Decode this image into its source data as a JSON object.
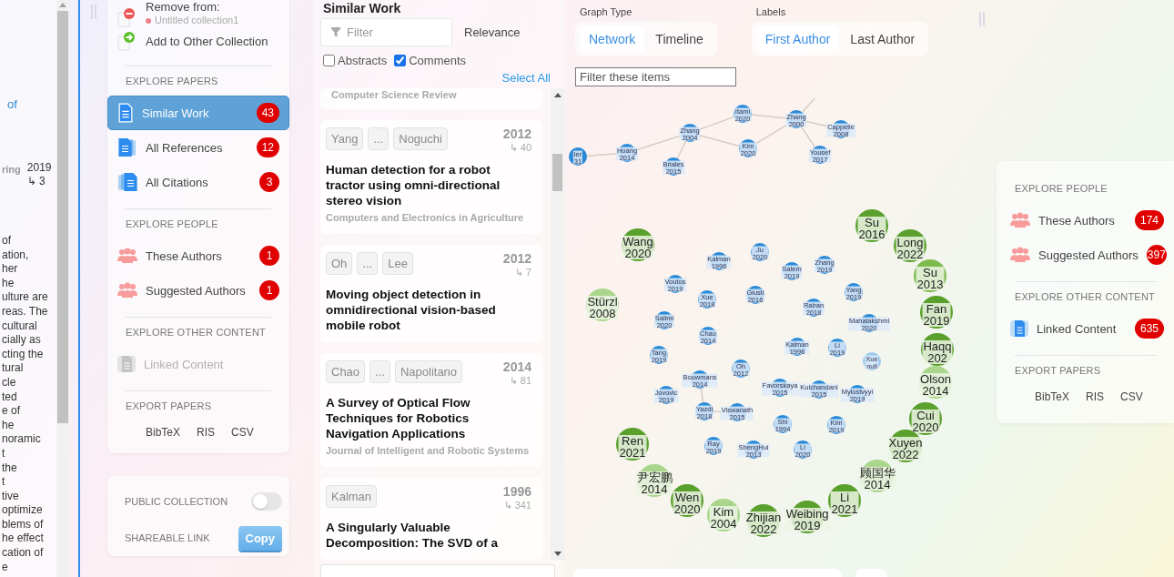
{
  "abstract_pane": {
    "link_fragment": "of",
    "item": {
      "title_fragment": "ring",
      "year": "2019",
      "citations": "↳ 3"
    },
    "text_lines": [
      "of",
      "ation,",
      "her",
      "he",
      "ulture are",
      "reas. The",
      "cultural",
      "cially as",
      "cting the",
      "tural",
      "cle",
      "ted",
      "e of",
      "he",
      "noramic",
      "t",
      "the",
      "t",
      "tive",
      "optimize",
      "blems of",
      "he effect",
      "cation of",
      "e"
    ]
  },
  "collection_panel": {
    "remove_label": "Remove from:",
    "collection": "Untitled collection1",
    "add_label": "Add to Other Collection",
    "sections": [
      {
        "heading": "EXPLORE PAPERS",
        "items": [
          {
            "kind": "papers",
            "label": "Similar Work",
            "count": "43",
            "selected": true,
            "disabled": false
          },
          {
            "kind": "references",
            "label": "All References",
            "count": "12",
            "selected": false,
            "disabled": false
          },
          {
            "kind": "citations",
            "label": "All Citations",
            "count": "3",
            "selected": false,
            "disabled": false
          }
        ]
      },
      {
        "heading": "EXPLORE PEOPLE",
        "items": [
          {
            "kind": "people",
            "label": "These Authors",
            "count": "1",
            "selected": false,
            "disabled": false
          },
          {
            "kind": "people",
            "label": "Suggested Authors",
            "count": "1",
            "selected": false,
            "disabled": false
          }
        ]
      },
      {
        "heading": "EXPLORE OTHER CONTENT",
        "items": [
          {
            "kind": "content",
            "label": "Linked Content",
            "selected": false,
            "disabled": true
          }
        ]
      }
    ],
    "export": {
      "heading": "EXPORT PAPERS",
      "formats": [
        "BibTeX",
        "RIS",
        "CSV"
      ]
    }
  },
  "sharing_panel": {
    "public_label": "PUBLIC COLLECTION",
    "public_on": false,
    "link_label": "SHAREABLE LINK",
    "copy_button": "Copy"
  },
  "results": {
    "title": "Similar Work",
    "filter_placeholder": "Filter",
    "sort": "Relevance",
    "options": [
      {
        "label": "Abstracts",
        "checked": false
      },
      {
        "label": "Comments",
        "checked": true
      }
    ],
    "select_all": "Select All",
    "papers": [
      {
        "kind": "tail",
        "venue": "Computer Science Review"
      },
      {
        "kind": "full",
        "authors": [
          "Yang",
          "...",
          "Noguchi"
        ],
        "year": "2012",
        "citations": "↳ 40",
        "title": "Human detection for a robot tractor using omni-directional stereo vision",
        "venue": "Computers and Electronics in Agriculture"
      },
      {
        "kind": "full",
        "authors": [
          "Oh",
          "...",
          "Lee"
        ],
        "year": "2012",
        "citations": "↳ 7",
        "title": "Moving object detection in omnidirectional vision-based mobile robot"
      },
      {
        "kind": "full",
        "authors": [
          "Chao",
          "...",
          "Napolitano"
        ],
        "year": "2014",
        "citations": "↳ 81",
        "title": "A Survey of Optical Flow Techniques for Robotics Navigation Applications",
        "venue": "Journal of Intelligent and Robotic Systems"
      },
      {
        "kind": "full",
        "authors": [
          "Kalman"
        ],
        "year": "1996",
        "citations": "↳ 341",
        "title": "A Singularly Valuable Decomposition: The SVD of a"
      }
    ]
  },
  "graph": {
    "graph_type_label": "Graph Type",
    "graph_types": [
      {
        "label": "Network",
        "selected": true
      },
      {
        "label": "Timeline",
        "selected": false
      }
    ],
    "labels_label": "Labels",
    "label_modes": [
      {
        "label": "First Author",
        "selected": true
      },
      {
        "label": "Last Author",
        "selected": false
      }
    ],
    "filter_placeholder": "Filter these items",
    "nodes": [
      {
        "kind": "minor",
        "name": "ler",
        "year": "31",
        "color": "#2a8ad8"
      },
      {
        "kind": "minor",
        "name": "Hoang",
        "year": "2014",
        "color": "#2a8ad8"
      },
      {
        "kind": "minor",
        "name": "Briales",
        "year": "2015",
        "color": "#2a8ad8"
      },
      {
        "kind": "minor",
        "name": "Zhang",
        "year": "2004",
        "color": "#2a8ad8"
      },
      {
        "kind": "minor",
        "name": "Itami",
        "year": "2020",
        "color": "#2a8ad8"
      },
      {
        "kind": "minor",
        "name": "Kim",
        "year": "2020",
        "color": "#2a8ad8"
      },
      {
        "kind": "minor",
        "name": "Zhang",
        "year": "2000",
        "color": "#2a8ad8"
      },
      {
        "kind": "minor",
        "name": "Cappelle",
        "year": "2008",
        "color": "#2a8ad8"
      },
      {
        "kind": "minor",
        "name": "Yousef",
        "year": "2017",
        "color": "#2a8ad8"
      },
      {
        "kind": "minor",
        "name": "Kalman",
        "year": "1996",
        "color": "#2a8ad8"
      },
      {
        "kind": "minor",
        "name": "Ju",
        "year": "2020",
        "color": "#2a8ad8"
      },
      {
        "kind": "minor",
        "name": "Salem",
        "year": "2019",
        "color": "#2a8ad8"
      },
      {
        "kind": "minor",
        "name": "Zhang",
        "year": "2019",
        "color": "#2a8ad8"
      },
      {
        "kind": "minor",
        "name": "Voutos",
        "year": "2019",
        "color": "#2a8ad8"
      },
      {
        "kind": "minor",
        "name": "Xue",
        "year": "2018",
        "color": "#2a8ad8"
      },
      {
        "kind": "minor",
        "name": "Giusti",
        "year": "2016",
        "color": "#2a8ad8"
      },
      {
        "kind": "minor",
        "name": "Yang",
        "year": "2019",
        "color": "#2a8ad8"
      },
      {
        "kind": "minor",
        "name": "Rairan",
        "year": "2018",
        "color": "#2a8ad8"
      },
      {
        "kind": "minor",
        "name": "Salimi",
        "year": "2020",
        "color": "#2a8ad8"
      },
      {
        "kind": "minor",
        "name": "Mahalakshmi",
        "year": "2020",
        "color": "#2a8ad8"
      },
      {
        "kind": "minor",
        "name": "Chao",
        "year": "2014",
        "color": "#2a8ad8"
      },
      {
        "kind": "minor",
        "name": "Tang",
        "year": "2019",
        "color": "#2a8ad8"
      },
      {
        "kind": "minor",
        "name": "Kalman",
        "year": "1996",
        "color": "#2a8ad8"
      },
      {
        "kind": "minor",
        "name": "Li",
        "year": "2019",
        "color": "#2a8ad8"
      },
      {
        "kind": "minor",
        "name": "Xue",
        "year": "null",
        "color": "#9cc9ef"
      },
      {
        "kind": "minor",
        "name": "Oh",
        "year": "2012",
        "color": "#2a8ad8"
      },
      {
        "kind": "minor",
        "name": "Bouwmans",
        "year": "2014",
        "color": "#2a8ad8"
      },
      {
        "kind": "minor",
        "name": "Jovovic",
        "year": "2019",
        "color": "#2a8ad8"
      },
      {
        "kind": "minor",
        "name": "Favorskaya",
        "year": "2015",
        "color": "#2a8ad8"
      },
      {
        "kind": "minor",
        "name": "Kulchandani",
        "year": "2015",
        "color": "#2a8ad8"
      },
      {
        "kind": "minor",
        "name": "Mylostvyyi",
        "year": "2019",
        "color": "#2a8ad8"
      },
      {
        "kind": "minor",
        "name": "Yazdi",
        "year": "2018",
        "color": "#2a8ad8"
      },
      {
        "kind": "minor",
        "name": "Viswanath",
        "year": "2015",
        "color": "#2a8ad8"
      },
      {
        "kind": "minor",
        "name": "Shi",
        "year": "1994",
        "color": "#2a8ad8"
      },
      {
        "kind": "minor",
        "name": "Kim",
        "year": "2019",
        "color": "#2a8ad8"
      },
      {
        "kind": "minor",
        "name": "Ray",
        "year": "2019",
        "color": "#2a8ad8"
      },
      {
        "kind": "minor",
        "name": "ShengHui",
        "year": "2013",
        "color": "#2a8ad8"
      },
      {
        "kind": "minor",
        "name": "Li",
        "year": "2020",
        "color": "#2a8ad8"
      },
      {
        "kind": "major",
        "name": "Su",
        "year": "2016",
        "color": "#5aa02c"
      },
      {
        "kind": "major",
        "name": "Wang",
        "year": "2020",
        "color": "#5aa02c"
      },
      {
        "kind": "major",
        "name": "Long",
        "year": "2022",
        "color": "#5aa02c"
      },
      {
        "kind": "major",
        "name": "Su",
        "year": "2013",
        "color": "#7dbb4e"
      },
      {
        "kind": "major",
        "name": "Stürzl",
        "year": "2008",
        "color": "#a9d68a"
      },
      {
        "kind": "major",
        "name": "Fan",
        "year": "2019",
        "color": "#5aa02c"
      },
      {
        "kind": "major",
        "name": "Haqq",
        "year": "202",
        "color": "#5aa02c"
      },
      {
        "kind": "major",
        "name": "Olson",
        "year": "2014",
        "color": "#a9d68a"
      },
      {
        "kind": "major",
        "name": "Cui",
        "year": "2020",
        "color": "#5aa02c"
      },
      {
        "kind": "major",
        "name": "Ren",
        "year": "2021",
        "color": "#5aa02c"
      },
      {
        "kind": "major",
        "name": "Xuyen",
        "year": "2022",
        "color": "#5aa02c"
      },
      {
        "kind": "major",
        "name": "尹宏鹏",
        "year": "2014",
        "color": "#a9d68a"
      },
      {
        "kind": "major",
        "name": "顾国华",
        "year": "2014",
        "color": "#a9d68a"
      },
      {
        "kind": "major",
        "name": "Wen",
        "year": "2020",
        "color": "#5aa02c"
      },
      {
        "kind": "major",
        "name": "Li",
        "year": "2021",
        "color": "#5aa02c"
      },
      {
        "kind": "major",
        "name": "Kim",
        "year": "2004",
        "color": "#a9d68a"
      },
      {
        "kind": "major",
        "name": "Zhijian",
        "year": "2022",
        "color": "#5aa02c"
      },
      {
        "kind": "major",
        "name": "Weibing",
        "year": "2019",
        "color": "#5aa02c"
      }
    ]
  },
  "side_panel": {
    "sections": [
      {
        "heading": "EXPLORE PEOPLE",
        "items": [
          {
            "kind": "people",
            "label": "These Authors",
            "count": "174",
            "selected": false,
            "disabled": false
          },
          {
            "kind": "people",
            "label": "Suggested Authors",
            "count": "397",
            "selected": false,
            "disabled": false
          }
        ]
      },
      {
        "heading": "EXPLORE OTHER CONTENT",
        "items": [
          {
            "kind": "content",
            "label": "Linked Content",
            "count": "635",
            "selected": false,
            "disabled": false
          }
        ]
      }
    ],
    "export": {
      "heading": "EXPORT PAPERS",
      "formats": [
        "BibTeX",
        "RIS",
        "CSV"
      ]
    }
  }
}
